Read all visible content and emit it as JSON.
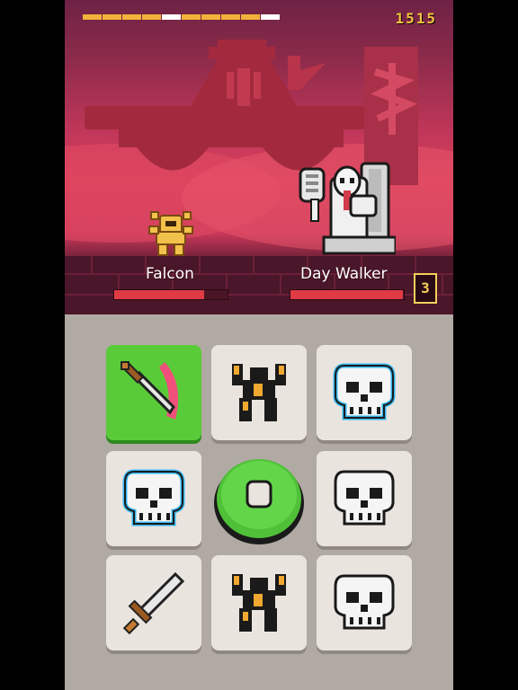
{
  "hud": {
    "score": "1515",
    "energy_segments": [
      "orange",
      "orange",
      "orange",
      "orange",
      "white",
      "orange",
      "orange",
      "orange",
      "orange",
      "white"
    ]
  },
  "battle": {
    "player": {
      "name": "Falcon",
      "health_fraction": 0.79
    },
    "enemy": {
      "name": "Day Walker",
      "health_fraction": 0.99
    },
    "turn_counter": "3"
  },
  "board": {
    "tiles": [
      "sword-strike",
      "warrior",
      "shielded-skull",
      "shielded-skull",
      "center-button",
      "skull",
      "sword",
      "warrior",
      "skull"
    ]
  },
  "colors": {
    "accent_green": "#5acb38",
    "health_red": "#e03b45",
    "score_gold": "#f5c341",
    "skull_shield_blue": "#35b6ee"
  }
}
